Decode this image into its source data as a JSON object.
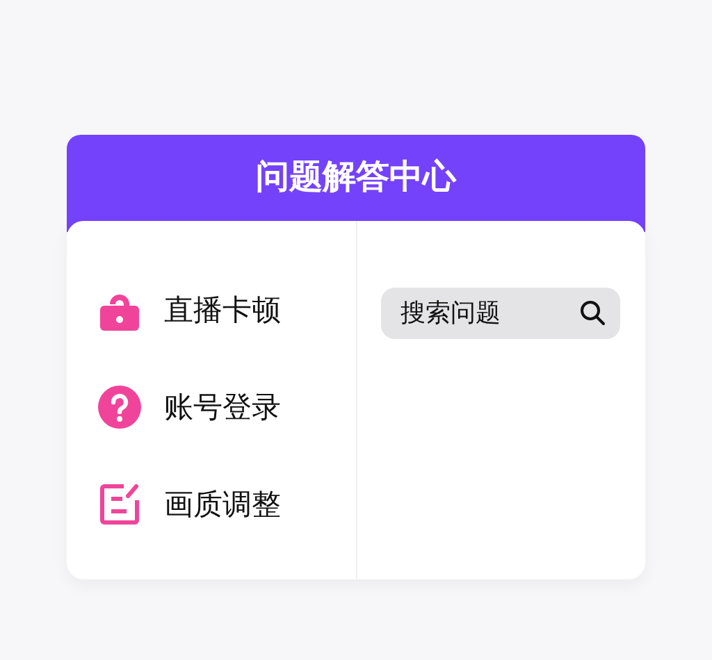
{
  "header": {
    "title": "问题解答中心"
  },
  "topics": [
    {
      "kind": "lock",
      "label": "直播卡顿"
    },
    {
      "kind": "question",
      "label": "账号登录"
    },
    {
      "kind": "edit",
      "label": "画质调整"
    }
  ],
  "search": {
    "placeholder": "搜索问题"
  }
}
